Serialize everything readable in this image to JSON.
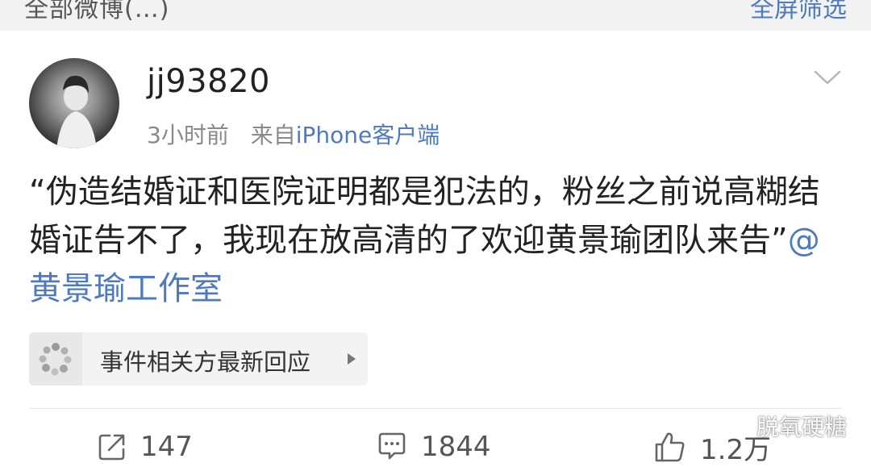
{
  "top_bar": {
    "left_text": "全部微博(…)",
    "right_text": "全屏筛选"
  },
  "post": {
    "username": "jj93820",
    "time": "3小时前",
    "source_prefix": "来自",
    "source_name": "iPhone客户端",
    "text": "“伪造结婚证和医院证明都是犯法的，粉丝之前说高糊结婚证告不了，我现在放高清的了欢迎黄景瑜团队来告”",
    "mention": "@黄景瑜工作室"
  },
  "event_card": {
    "label": "事件相关方最新回应"
  },
  "actions": {
    "repost_count": "147",
    "comment_count": "1844",
    "like_count": "1.2万"
  },
  "watermark": {
    "text": "脱氧硬糖"
  },
  "colors": {
    "link": "#4e7bbf",
    "text": "#222222",
    "meta": "#8a8a8a"
  }
}
